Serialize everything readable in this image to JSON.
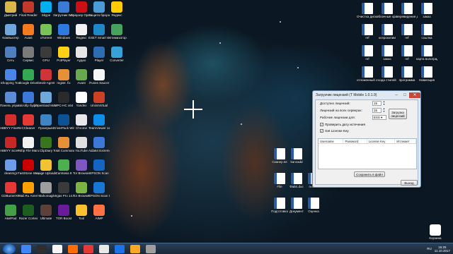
{
  "desktop_icons_left": [
    {
      "label": "Дмитрий",
      "color": "#d9b64a"
    },
    {
      "label": "Final Reader",
      "color": "#c0392b"
    },
    {
      "label": "Skype",
      "color": "#00aff0"
    },
    {
      "label": "Загрузчик Windows",
      "color": "#3a7bd5"
    },
    {
      "label": "Браузер Opera",
      "color": "#cc0f16"
    },
    {
      "label": "Защита браузера",
      "color": "#4b9bd6"
    },
    {
      "label": "Яндекс",
      "color": "#ffcc00"
    },
    {
      "label": "Компьютер",
      "color": "#6fa8dc"
    },
    {
      "label": "Avast",
      "color": "#f47a20"
    },
    {
      "label": "uTorrent",
      "color": "#78c257"
    },
    {
      "label": "Windows",
      "color": "#2d7be0"
    },
    {
      "label": "Яндекс",
      "color": "#f2f2f2"
    },
    {
      "label": "ESET Smart Security",
      "color": "#1e88c8"
    },
    {
      "label": "Оптимизатор",
      "color": "#46a35e"
    },
    {
      "label": "Сеть",
      "color": "#4f7fbf"
    },
    {
      "label": "Сервис",
      "color": "#7a7a7a"
    },
    {
      "label": "GPU",
      "color": "#3b3b3b"
    },
    {
      "label": "PotPlayer",
      "color": "#fcd116"
    },
    {
      "label": "Аудио",
      "color": "#e6e6e6"
    },
    {
      "label": "Player",
      "color": "#2f6db3"
    },
    {
      "label": "Converter",
      "color": "#35a2d8"
    },
    {
      "label": "Shopping Tool",
      "color": "#4a86e8"
    },
    {
      "label": "Google Drive",
      "color": "#34a853"
    },
    {
      "label": "DeviD Agent",
      "color": "#d13438"
    },
    {
      "label": "registr. fix",
      "color": "#e69138"
    },
    {
      "label": "Avant",
      "color": "#6aa84f"
    },
    {
      "label": "iTunes Saucer",
      "color": "#f5f5f5"
    },
    {
      "label": "",
      "color": "#00000000"
    },
    {
      "label": "Панель управления",
      "color": "#5b8dd6"
    },
    {
      "label": "microfip буфер",
      "color": "#3c78d8"
    },
    {
      "label": "Download Master",
      "color": "#6fa8dc"
    },
    {
      "label": "MPC-HC x64",
      "color": "#2b2b2b"
    },
    {
      "label": "Yandex",
      "color": "#ffffff"
    },
    {
      "label": "UninsVirtual",
      "color": "#cc4125"
    },
    {
      "label": "",
      "color": "#00000000"
    },
    {
      "label": "ABBYY FineReader",
      "color": "#d32f2f"
    },
    {
      "label": "CCleaner",
      "color": "#e53935"
    },
    {
      "label": "Проигрыв.",
      "color": "#3d85c6"
    },
    {
      "label": "DriverPack Windows",
      "color": "#0b5394"
    },
    {
      "label": "Chrome",
      "color": "#e8e8e8"
    },
    {
      "label": "TeamViewer 12 x64",
      "color": "#0e8ee9"
    },
    {
      "label": "",
      "color": "#00000000"
    },
    {
      "label": "ABBYY Screenshot",
      "color": "#c62828"
    },
    {
      "label": "7-Zip File Manager",
      "color": "#f0f0f0"
    },
    {
      "label": "ClipDiary",
      "color": "#38761d"
    },
    {
      "label": "Total Commander",
      "color": "#e69138"
    },
    {
      "label": "YouTube",
      "color": "#e0e0e0"
    },
    {
      "label": "Aida64 Extreme",
      "color": "#3c78d8"
    },
    {
      "label": "",
      "color": "#00000000"
    },
    {
      "label": "cleanmgr",
      "color": "#6d9eeb"
    },
    {
      "label": "FastStone Image Viewer",
      "color": "#cc0000"
    },
    {
      "label": "Image Uploader",
      "color": "#f1c232"
    },
    {
      "label": "Camtasia 9",
      "color": "#4caf50"
    },
    {
      "label": "Tor Browser",
      "color": "#7e57c2"
    },
    {
      "label": "EPSON Scan",
      "color": "#1565c0"
    },
    {
      "label": "",
      "color": "#00000000"
    },
    {
      "label": "CDBurnerXP",
      "color": "#e53935"
    },
    {
      "label": "Mail.Ru Агент",
      "color": "#ffa000"
    },
    {
      "label": "Mahomagi",
      "color": "#9e9e9e"
    },
    {
      "label": "Vegas Pro 14.0 (64-bit)",
      "color": "#3a3a3a"
    },
    {
      "label": "Tor Browser",
      "color": "#7cb342"
    },
    {
      "label": "EPSON Scan Settings",
      "color": "#1976d2"
    },
    {
      "label": "",
      "color": "#00000000"
    },
    {
      "label": "AkelPad",
      "color": "#43a047"
    },
    {
      "label": "Razer Cortex",
      "color": "#1b5e20"
    },
    {
      "label": "Ultimate",
      "color": "#5d4037"
    },
    {
      "label": "TOR Boost",
      "color": "#6a1b9a"
    },
    {
      "label": "Tool",
      "color": "#fbc02d"
    },
    {
      "label": "AIMP",
      "color": "#ff7043"
    },
    {
      "label": "",
      "color": "#00000000"
    }
  ],
  "desktop_icons_right": [
    {
      "label": "Очистка диска в Wi..."
    },
    {
      "label": "облачные хранилища"
    },
    {
      "label": "переведение диска"
    },
    {
      "label": "заказ"
    },
    {
      "label": "ref"
    },
    {
      "label": "ксерокопии"
    },
    {
      "label": "ref"
    },
    {
      "label": "ссылка"
    },
    {
      "label": "ref"
    },
    {
      "label": "заказ"
    },
    {
      "label": "ref"
    },
    {
      "label": "карта волоградская"
    },
    {
      "label": "отложенный ответ"
    },
    {
      "label": "кода стилей"
    },
    {
      "label": "программа"
    },
    {
      "label": "Навигация"
    },
    {
      "label": "Корзина"
    }
  ],
  "desktop_icons_middle": [
    {
      "label": "Сканер.txt"
    },
    {
      "label": "kanzadd"
    },
    {
      "label": "File"
    },
    {
      "label": "Файл.doc"
    },
    {
      "label": "reader"
    },
    {
      "label": "Подготовка"
    },
    {
      "label": "Документ"
    },
    {
      "label": "Оценка"
    }
  ],
  "window": {
    "title": "Загрузчик лицензий (Т Mobile 1.0.1.9)",
    "minimize": "–",
    "maximize": "□",
    "close": "✕",
    "available_label": "Доступно лицензий:",
    "available_value": "15",
    "per_server_label": "Лицензий на всех серверах:",
    "per_server_value": "15",
    "working_label": "Рабочие лицензии для:",
    "working_value": "ESS",
    "load_button": "Загрузка лицензий",
    "check_date": "Проверить дату истечения",
    "get_license": "Get License Key",
    "columns": [
      "Username",
      "Password",
      "License Key",
      "Истекает"
    ],
    "save_button": "Сохранить в файл",
    "exit_button": "Выход"
  },
  "taskbar": {
    "lang": "RU",
    "time": "15:25",
    "date": "11.10.2017",
    "items": [
      "#4285f4",
      "#2d2d2d",
      "#f5f5f5",
      "#ff6d00",
      "#e53935",
      "#e8e8e8",
      "#1a73e8",
      "#f9a825",
      "#9e9e9e"
    ]
  }
}
